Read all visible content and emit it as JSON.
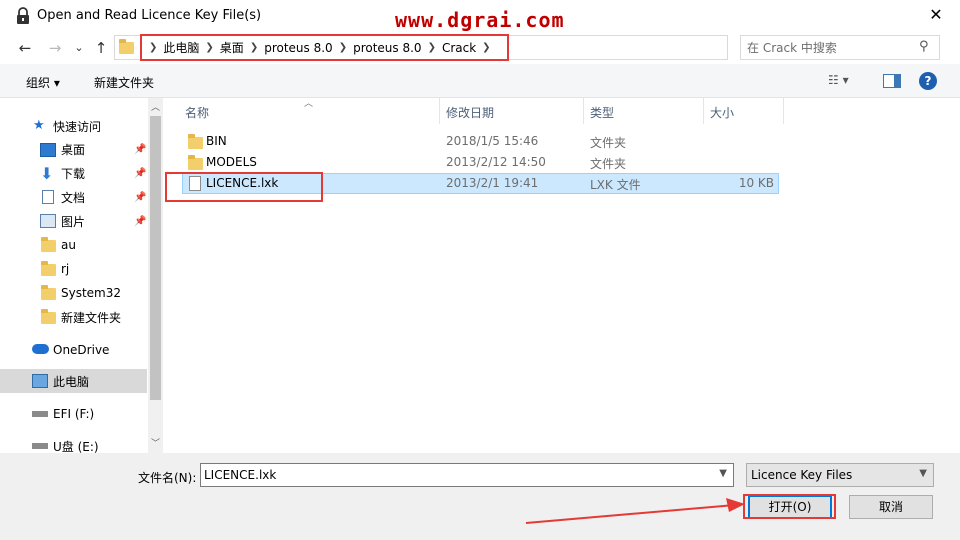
{
  "window": {
    "title": "Open and Read Licence Key File(s)",
    "watermark": "www.dgrai.com",
    "close_glyph": "✕"
  },
  "nav": {
    "back": "←",
    "forward": "→",
    "recent": "⌄",
    "up": "↑",
    "breadcrumbs": [
      "此电脑",
      "桌面",
      "proteus 8.0",
      "proteus 8.0",
      "Crack"
    ],
    "search_placeholder": "在 Crack 中搜索"
  },
  "toolbar": {
    "organize": "组织 ▾",
    "new_folder": "新建文件夹",
    "help": "?"
  },
  "sidebar": {
    "items": [
      {
        "label": "快速访问",
        "icon": "star-icon",
        "pinned": false
      },
      {
        "label": "桌面",
        "icon": "desktop-icon",
        "pinned": true
      },
      {
        "label": "下载",
        "icon": "download-icon",
        "pinned": true
      },
      {
        "label": "文档",
        "icon": "document-icon",
        "pinned": true
      },
      {
        "label": "图片",
        "icon": "picture-icon",
        "pinned": true
      },
      {
        "label": "au",
        "icon": "folder-icon",
        "pinned": false
      },
      {
        "label": "rj",
        "icon": "folder-icon",
        "pinned": false
      },
      {
        "label": "System32",
        "icon": "folder-icon",
        "pinned": false
      },
      {
        "label": "新建文件夹",
        "icon": "folder-icon",
        "pinned": false
      },
      {
        "label": "OneDrive",
        "icon": "cloud-icon",
        "pinned": false
      },
      {
        "label": "此电脑",
        "icon": "computer-icon",
        "pinned": false,
        "selected": true
      },
      {
        "label": "EFI (F:)",
        "icon": "drive-icon",
        "pinned": false
      },
      {
        "label": "U盘 (E:)",
        "icon": "drive-icon",
        "pinned": false
      }
    ]
  },
  "filelist": {
    "columns": [
      "名称",
      "修改日期",
      "类型",
      "大小"
    ],
    "rows": [
      {
        "name": "BIN",
        "date": "2018/1/5 15:46",
        "type": "文件夹",
        "size": "",
        "kind": "folder"
      },
      {
        "name": "MODELS",
        "date": "2013/2/12 14:50",
        "type": "文件夹",
        "size": "",
        "kind": "folder"
      },
      {
        "name": "LICENCE.lxk",
        "date": "2013/2/1 19:41",
        "type": "LXK 文件",
        "size": "10 KB",
        "kind": "file",
        "selected": true
      }
    ]
  },
  "footer": {
    "filename_label": "文件名(N):",
    "filename_value": "LICENCE.lxk",
    "filetype": "Licence Key Files",
    "open_button": "打开(O)",
    "cancel_button": "取消"
  },
  "colors": {
    "annotation_red": "#e53935",
    "selection_bg": "#cce8ff",
    "watermark": "#c00000"
  }
}
